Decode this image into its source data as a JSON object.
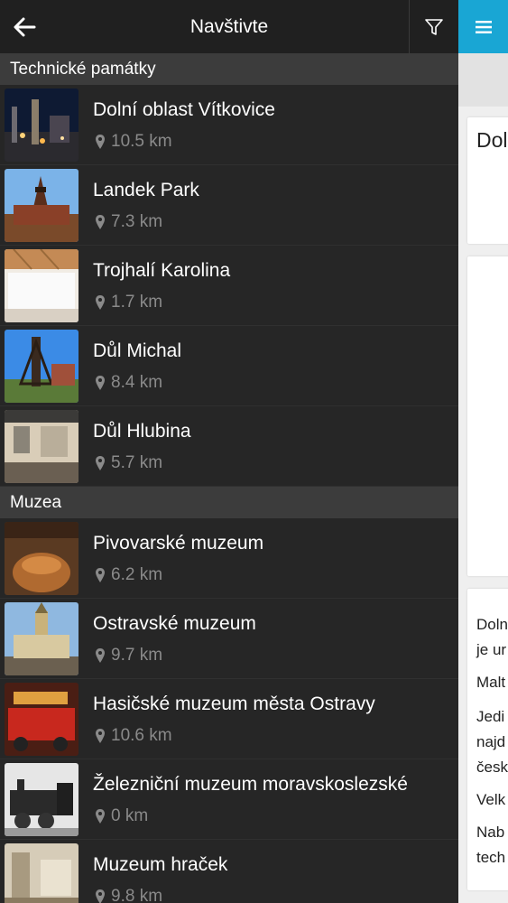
{
  "header": {
    "title": "Navštivte",
    "back_icon": "arrow-left-icon",
    "filter_icon": "filter-icon"
  },
  "sections": [
    {
      "title": "Technické památky",
      "items": [
        {
          "name": "Dolní oblast Vítkovice",
          "distance": "10.5 km"
        },
        {
          "name": "Landek Park",
          "distance": "7.3 km"
        },
        {
          "name": "Trojhalí Karolina",
          "distance": "1.7 km"
        },
        {
          "name": "Důl Michal",
          "distance": "8.4 km"
        },
        {
          "name": "Důl Hlubina",
          "distance": "5.7 km"
        }
      ]
    },
    {
      "title": "Muzea",
      "items": [
        {
          "name": "Pivovarské muzeum",
          "distance": "6.2 km"
        },
        {
          "name": "Ostravské muzeum",
          "distance": "9.7 km"
        },
        {
          "name": "Hasičské muzeum města Ostravy",
          "distance": "10.6 km"
        },
        {
          "name": "Železniční muzeum moravskoslezské",
          "distance": "0 km"
        },
        {
          "name": "Muzeum hraček",
          "distance": "9.8 km"
        }
      ]
    }
  ],
  "right_panel": {
    "menu_icon": "hamburger-menu-icon",
    "accent_color": "#19a6d4",
    "title_fragment": "Dol",
    "text_fragments": [
      "Doln",
      "je ur",
      "Malt",
      "Jedi",
      "najd",
      "česk",
      "Velk",
      "Nab",
      "tech"
    ]
  }
}
